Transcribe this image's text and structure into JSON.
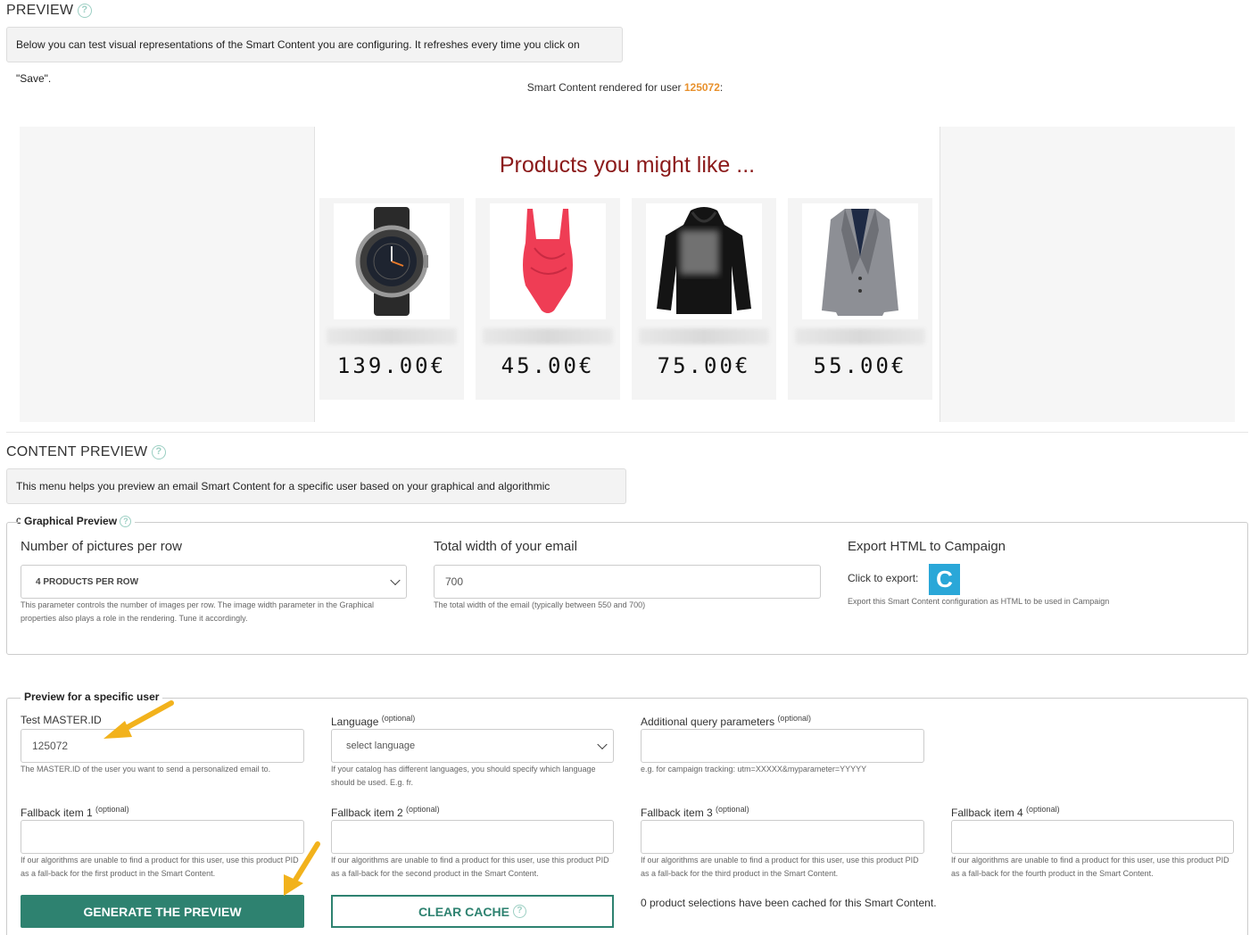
{
  "preview": {
    "title": "PREVIEW",
    "info": "Below you can test visual representations of the Smart Content you are configuring. It refreshes every time you click on \"Save\".",
    "rendered_prefix": "Smart Content rendered for user",
    "rendered_user": "125072",
    "rendered_suffix": ":",
    "heading": "Products you might like ...",
    "products": [
      {
        "price": "139.00€",
        "image": "watch"
      },
      {
        "price": "45.00€",
        "image": "swimsuit"
      },
      {
        "price": "75.00€",
        "image": "hoodie"
      },
      {
        "price": "55.00€",
        "image": "blazer"
      }
    ]
  },
  "content_preview": {
    "title": "CONTENT PREVIEW",
    "info": "This menu helps you preview an email Smart Content for a specific user based on your graphical and algorithmic configuration."
  },
  "graphical": {
    "legend": "Graphical Preview",
    "pictures_label": "Number of pictures per row",
    "pictures_value": "4 PRODUCTS PER ROW",
    "pictures_hint": "This parameter controls the number of images per row. The image width parameter in the Graphical properties also plays a role in the rendering. Tune it accordingly.",
    "width_label": "Total width of your email",
    "width_value": "700",
    "width_hint": "The total width of the email (typically between 550 and 700)",
    "export_label": "Export HTML to Campaign",
    "export_click": "Click to export:",
    "export_hint": "Export this Smart Content configuration as HTML to be used in Campaign",
    "export_icon_letter": "C"
  },
  "user_preview": {
    "legend": "Preview for a specific user",
    "master_label": "Test MASTER.ID",
    "master_value": "125072",
    "master_hint": "The MASTER.ID of the user you want to send a personalized email to.",
    "language_label": "Language",
    "optional": "(optional)",
    "language_value": "select language",
    "language_hint": "If your catalog has different languages, you should specify which language should be used. E.g. fr.",
    "query_label": "Additional query parameters",
    "query_hint": "e.g. for campaign tracking: utm=XXXXX&myparameter=YYYYY",
    "fallback1_label": "Fallback item 1",
    "fallback1_hint": "If our algorithms are unable to find a product for this user, use this product PID as a fall-back for the first product in the Smart Content.",
    "fallback2_label": "Fallback item 2",
    "fallback2_hint": "If our algorithms are unable to find a product for this user, use this product PID as a fall-back for the second product in the Smart Content.",
    "fallback3_label": "Fallback item 3",
    "fallback3_hint": "If our algorithms are unable to find a product for this user, use this product PID as a fall-back for the third product in the Smart Content.",
    "fallback4_label": "Fallback item 4",
    "fallback4_hint": "If our algorithms are unable to find a product for this user, use this product PID as a fall-back for the fourth product in the Smart Content.",
    "generate_label": "GENERATE THE PREVIEW",
    "clear_label": "CLEAR CACHE",
    "cache_status": "0 product selections have been cached for this Smart Content."
  },
  "colors": {
    "accent": "#2e8270",
    "user_id": "#e8912d",
    "heading": "#8b1a1a",
    "arrow": "#f2b21c"
  }
}
